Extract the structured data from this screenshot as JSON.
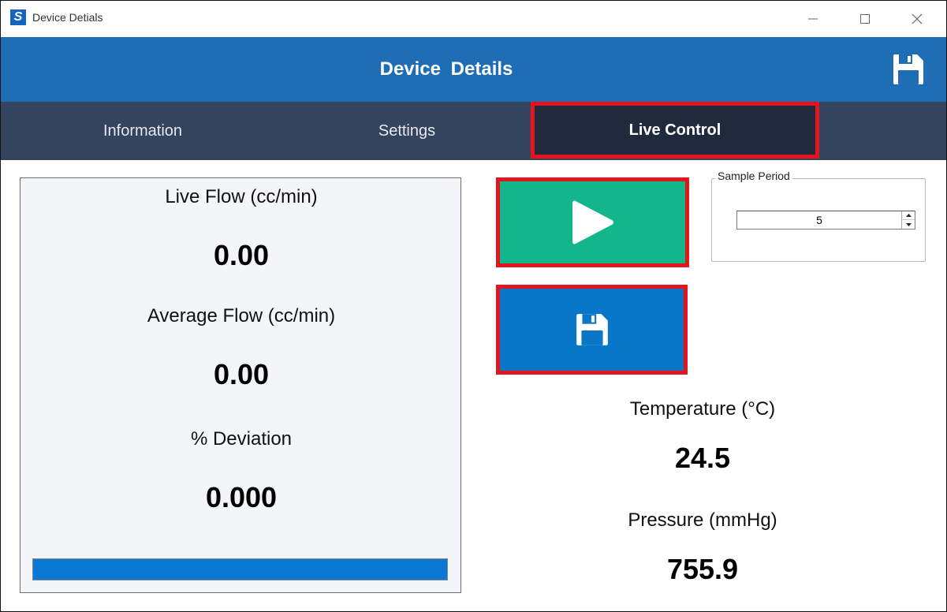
{
  "window": {
    "title": "Device Detials"
  },
  "header": {
    "title": "Device Details"
  },
  "tabs": [
    {
      "label": "Information"
    },
    {
      "label": "Settings"
    },
    {
      "label": "Live Control"
    }
  ],
  "flow": {
    "live_label": "Live Flow (cc/min)",
    "live_value": "0.00",
    "average_label": "Average Flow (cc/min)",
    "average_value": "0.00",
    "deviation_label": "% Deviation",
    "deviation_value": "0.000",
    "progress_percent": 100
  },
  "sample_period": {
    "label": "Sample Period",
    "value": "5"
  },
  "readings": {
    "temperature_label": "Temperature (°C)",
    "temperature_value": "24.5",
    "pressure_label": "Pressure (mmHg)",
    "pressure_value": "755.9"
  },
  "colors": {
    "header": "#1f6db5",
    "tabbar": "#34435e",
    "active_tab": "#202a3d",
    "highlight": "#e3141b",
    "play": "#12b68a",
    "save": "#0a76c8",
    "progress": "#0a78d4"
  },
  "icons": {
    "app": "app-logo-icon",
    "header_save": "floppy-disk-icon",
    "play": "play-icon",
    "save": "floppy-disk-icon"
  }
}
